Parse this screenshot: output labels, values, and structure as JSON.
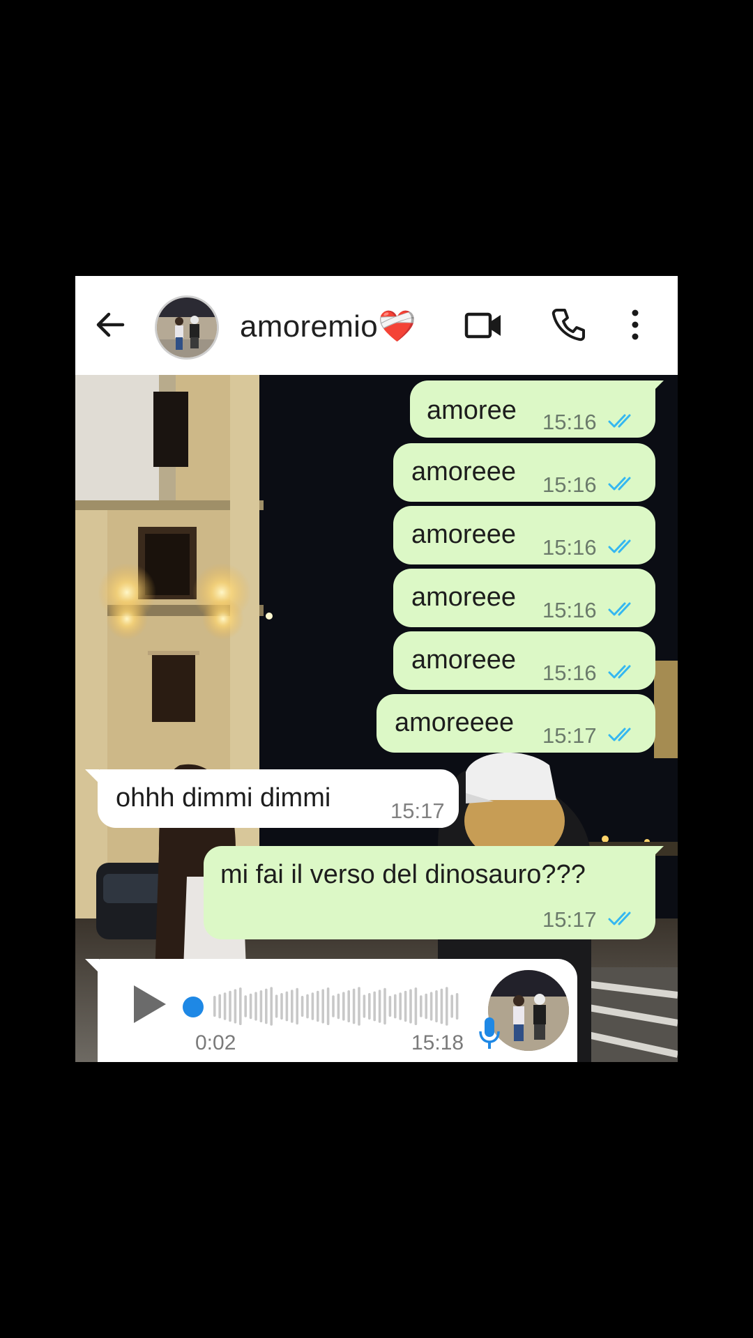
{
  "header": {
    "contact_name": "amoremio❤️‍🩹"
  },
  "icons": {
    "back": "arrow-left-icon",
    "video": "video-camera-icon",
    "call": "phone-icon",
    "menu": "more-vertical-icon",
    "ticks": "double-check-read-icon",
    "mic": "microphone-icon",
    "play": "play-icon"
  },
  "colors": {
    "outgoing_bubble": "#dcf8c6",
    "incoming_bubble": "#ffffff",
    "read_ticks": "#34b7f1",
    "voice_accent": "#1e88e5"
  },
  "messages": [
    {
      "direction": "out",
      "text": "amoree",
      "time": "15:16",
      "read": true
    },
    {
      "direction": "out",
      "text": "amoreee",
      "time": "15:16",
      "read": true
    },
    {
      "direction": "out",
      "text": "amoreee",
      "time": "15:16",
      "read": true
    },
    {
      "direction": "out",
      "text": "amoreee",
      "time": "15:16",
      "read": true
    },
    {
      "direction": "out",
      "text": "amoreee",
      "time": "15:16",
      "read": true
    },
    {
      "direction": "out",
      "text": "amoreeee",
      "time": "15:17",
      "read": true
    },
    {
      "direction": "in",
      "text": "ohhh dimmi dimmi",
      "time": "15:17"
    },
    {
      "direction": "out",
      "text": "mi fai il verso del dinosauro???",
      "time": "15:17",
      "read": true
    }
  ],
  "voice_message": {
    "direction": "in",
    "duration": "0:02",
    "time": "15:18",
    "progress": 0
  }
}
